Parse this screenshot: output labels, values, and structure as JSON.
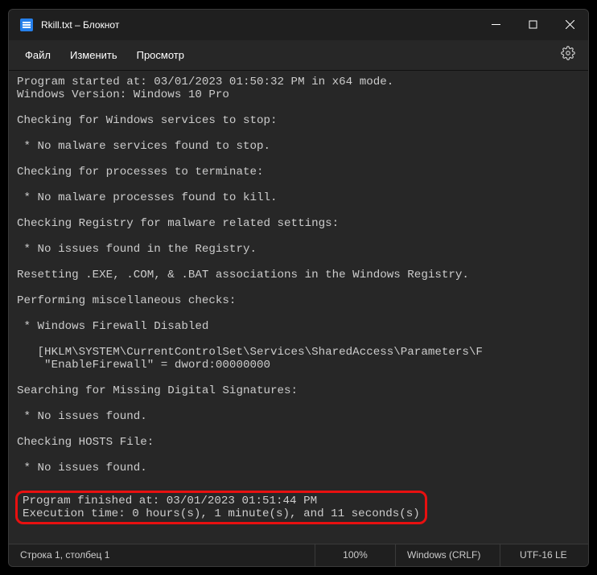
{
  "titlebar": {
    "title": "Rkill.txt – Блокнот"
  },
  "menu": {
    "file": "Файл",
    "edit": "Изменить",
    "view": "Просмотр"
  },
  "content": {
    "l01": "Program started at: 03/01/2023 01:50:32 PM in x64 mode.",
    "l02": "Windows Version: Windows 10 Pro",
    "l03": "",
    "l04": "Checking for Windows services to stop:",
    "l05": "",
    "l06": " * No malware services found to stop.",
    "l07": "",
    "l08": "Checking for processes to terminate:",
    "l09": "",
    "l10": " * No malware processes found to kill.",
    "l11": "",
    "l12": "Checking Registry for malware related settings:",
    "l13": "",
    "l14": " * No issues found in the Registry.",
    "l15": "",
    "l16": "Resetting .EXE, .COM, & .BAT associations in the Windows Registry.",
    "l17": "",
    "l18": "Performing miscellaneous checks:",
    "l19": "",
    "l20": " * Windows Firewall Disabled",
    "l21": "",
    "l22": "   [HKLM\\SYSTEM\\CurrentControlSet\\Services\\SharedAccess\\Parameters\\F",
    "l23": "    \"EnableFirewall\" = dword:00000000",
    "l24": "",
    "l25": "Searching for Missing Digital Signatures:",
    "l26": "",
    "l27": " * No issues found.",
    "l28": "",
    "l29": "Checking HOSTS File:",
    "l30": "",
    "l31": " * No issues found.",
    "l32": "",
    "hl1": "Program finished at: 03/01/2023 01:51:44 PM",
    "hl2": "Execution time: 0 hours(s), 1 minute(s), and 11 seconds(s)"
  },
  "status": {
    "position": "Строка 1, столбец 1",
    "zoom": "100%",
    "encoding": "Windows (CRLF)",
    "charset": "UTF-16 LE"
  }
}
